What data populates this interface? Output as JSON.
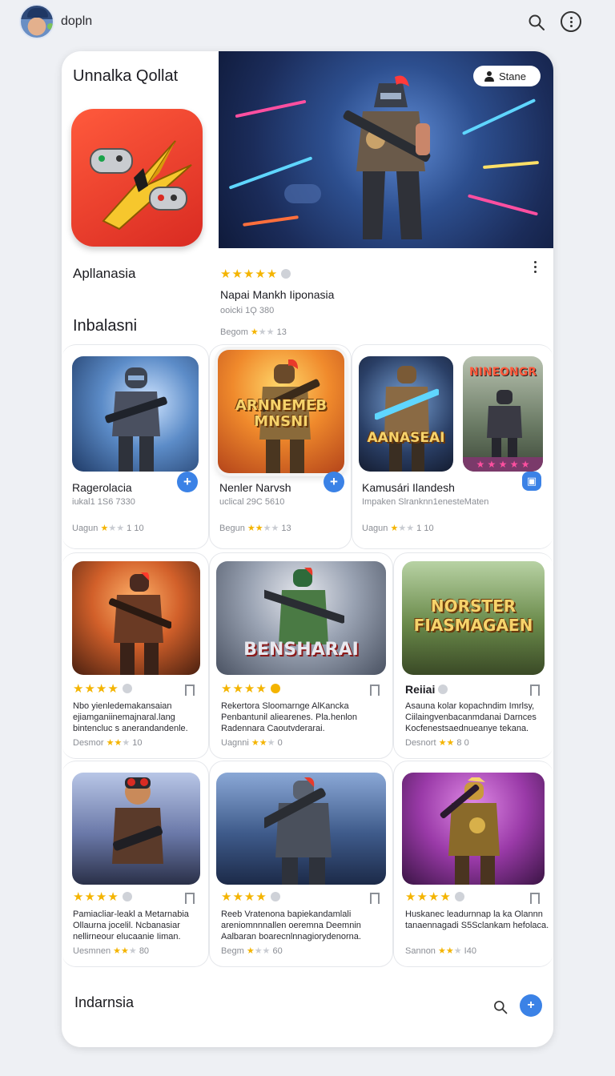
{
  "header": {
    "username": "dopln"
  },
  "featured": {
    "section_title": "Unnalka Qollat",
    "app_name": "Apllanasia",
    "share_label": "Stane",
    "rating_stars": "★★★★★",
    "title": "Napai Mankh Iiponasia",
    "subtitle": "ooicki 1Ǫ 380",
    "meta_prefix": "Begom",
    "meta_stars": "★",
    "meta_stars_gray": "★★",
    "meta_count": "13"
  },
  "section2": {
    "title": "Inbalasni",
    "cards": [
      {
        "title": "Ragerolacia",
        "subtitle": "iukal1 1S6 7330",
        "meta_prefix": "Uagun",
        "stars": "★",
        "stars_gray": "★★",
        "count": "1 10",
        "thumb_label": ""
      },
      {
        "title": "Nenler Narvsh",
        "subtitle": "uclical 29C 5610",
        "meta_prefix": "Begun",
        "stars": "★★",
        "stars_gray": "★★",
        "count": "13",
        "thumb_label": "ARNNEMEB MNSNI"
      },
      {
        "title": "Kamusári Ilandesh",
        "subtitle": "Impaken Slranknn1enesteMaten",
        "meta_prefix": "Uagun",
        "stars": "★",
        "stars_gray": "★★",
        "count": "1 10",
        "thumb_label": "AANASEAI",
        "thumb_label_2": "NINEONGR"
      }
    ]
  },
  "grid_row1": [
    {
      "stars": "★★★★",
      "desc": "Nbo yienledemakansaian ejiamganiinemajnaral.lang bintencluc s anerandandenle.",
      "meta_prefix": "Desmor",
      "meta_stars": "★★",
      "meta_stars_gray": "★",
      "count": "10",
      "title": "",
      "thumb_label": ""
    },
    {
      "stars": "★★★★",
      "desc": "Rekertora Sloomarnge AlKancka Penbantunil aliearenes. Pla.henlon Radennara Caoutvderarai.",
      "meta_prefix": "Uagnni",
      "meta_stars": "★★",
      "meta_stars_gray": "★",
      "count": "0",
      "title": "",
      "thumb_label": "BENSHARAI"
    },
    {
      "stars": "",
      "desc": "Asauna kolar kopachndim Imrlsy, Ciilaingvenbacanmdanai Darnces Kocfenestsaednueanye tekana.",
      "meta_prefix": "Desnort",
      "meta_stars": "★★",
      "meta_stars_gray": "",
      "count": "8 0",
      "title": "Reiiai",
      "thumb_label": "NORSTER FIASMAGAEN"
    }
  ],
  "grid_row2": [
    {
      "stars": "★★★★",
      "desc": "Pamiacliar-leakl a Metarnabia Ollaurna jocelil. Ncbanasiar nellirneour elucaanie Iiman.",
      "meta_prefix": "Uesmnen",
      "meta_stars": "★★",
      "meta_stars_gray": "★",
      "count": "80"
    },
    {
      "stars": "★★★★",
      "desc": "Reeb Vratenona bapiekandamlali areniomnnnallen oeremna Deemnin Aalbaran boarecnlnnagiorydenorna.",
      "meta_prefix": "Begm",
      "meta_stars": "★",
      "meta_stars_gray": "★★",
      "count": "60"
    },
    {
      "stars": "★★★★",
      "desc": "Huskanec leadurnnap la ka Olannn tanaennagadi S5Sclankam hefolaca.",
      "meta_prefix": "Sannon",
      "meta_stars": "★★",
      "meta_stars_gray": "★",
      "count": "I40"
    }
  ],
  "footer": {
    "title": "Indarnsia"
  }
}
